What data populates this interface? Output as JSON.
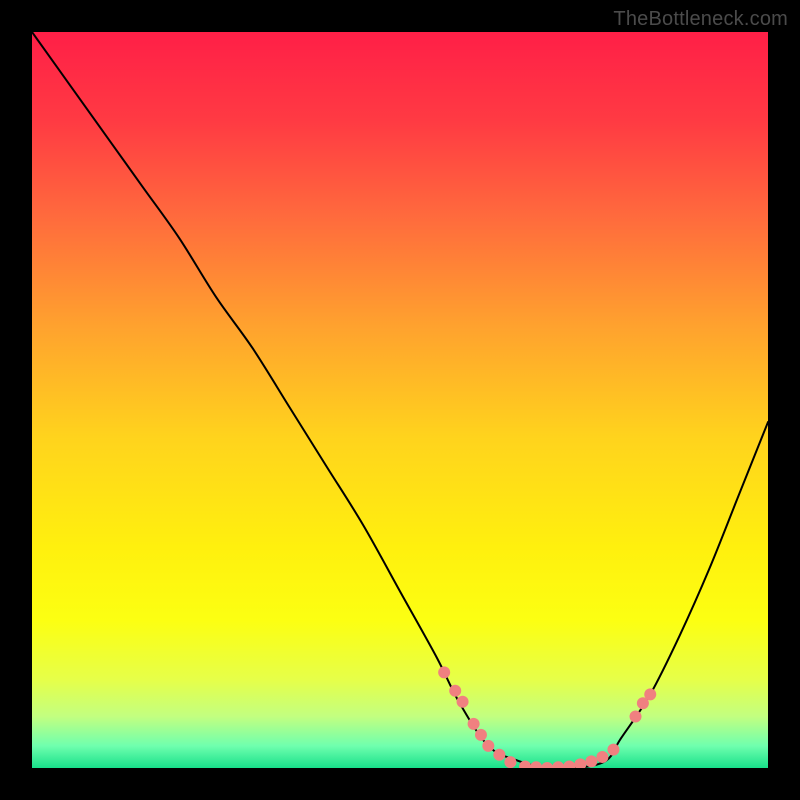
{
  "watermark": "TheBottleneck.com",
  "chart_data": {
    "type": "line",
    "title": "",
    "xlabel": "",
    "ylabel": "",
    "xlim": [
      0,
      100
    ],
    "ylim": [
      0,
      100
    ],
    "grid": false,
    "legend": false,
    "background_gradient": {
      "direction": "vertical",
      "stops": [
        {
          "offset": 0.0,
          "color": "#ff1f47"
        },
        {
          "offset": 0.12,
          "color": "#ff3a43"
        },
        {
          "offset": 0.25,
          "color": "#ff6a3d"
        },
        {
          "offset": 0.4,
          "color": "#ffa22e"
        },
        {
          "offset": 0.55,
          "color": "#ffd31d"
        },
        {
          "offset": 0.7,
          "color": "#fff00e"
        },
        {
          "offset": 0.8,
          "color": "#fcff12"
        },
        {
          "offset": 0.88,
          "color": "#e6ff49"
        },
        {
          "offset": 0.93,
          "color": "#c2ff80"
        },
        {
          "offset": 0.97,
          "color": "#6fffae"
        },
        {
          "offset": 1.0,
          "color": "#18e08a"
        }
      ]
    },
    "series": [
      {
        "name": "bottleneck-curve",
        "type": "line",
        "color": "#000000",
        "stroke_width": 2,
        "x": [
          0,
          5,
          10,
          15,
          20,
          25,
          30,
          35,
          40,
          45,
          50,
          55,
          58,
          62,
          66,
          70,
          74,
          78,
          80,
          84,
          88,
          92,
          96,
          100
        ],
        "y": [
          100,
          93,
          86,
          79,
          72,
          64,
          57,
          49,
          41,
          33,
          24,
          15,
          9,
          3,
          1,
          0,
          0,
          1,
          4,
          10,
          18,
          27,
          37,
          47
        ]
      },
      {
        "name": "sample-dots",
        "type": "scatter",
        "color": "#f08080",
        "radius": 6,
        "points": [
          {
            "x": 56.0,
            "y": 13.0
          },
          {
            "x": 57.5,
            "y": 10.5
          },
          {
            "x": 58.5,
            "y": 9.0
          },
          {
            "x": 60.0,
            "y": 6.0
          },
          {
            "x": 61.0,
            "y": 4.5
          },
          {
            "x": 62.0,
            "y": 3.0
          },
          {
            "x": 63.5,
            "y": 1.8
          },
          {
            "x": 65.0,
            "y": 0.8
          },
          {
            "x": 67.0,
            "y": 0.2
          },
          {
            "x": 68.5,
            "y": 0.1
          },
          {
            "x": 70.0,
            "y": 0.0
          },
          {
            "x": 71.5,
            "y": 0.1
          },
          {
            "x": 73.0,
            "y": 0.2
          },
          {
            "x": 74.5,
            "y": 0.5
          },
          {
            "x": 76.0,
            "y": 0.9
          },
          {
            "x": 77.5,
            "y": 1.5
          },
          {
            "x": 79.0,
            "y": 2.5
          },
          {
            "x": 82.0,
            "y": 7.0
          },
          {
            "x": 83.0,
            "y": 8.8
          },
          {
            "x": 84.0,
            "y": 10.0
          }
        ]
      }
    ]
  }
}
